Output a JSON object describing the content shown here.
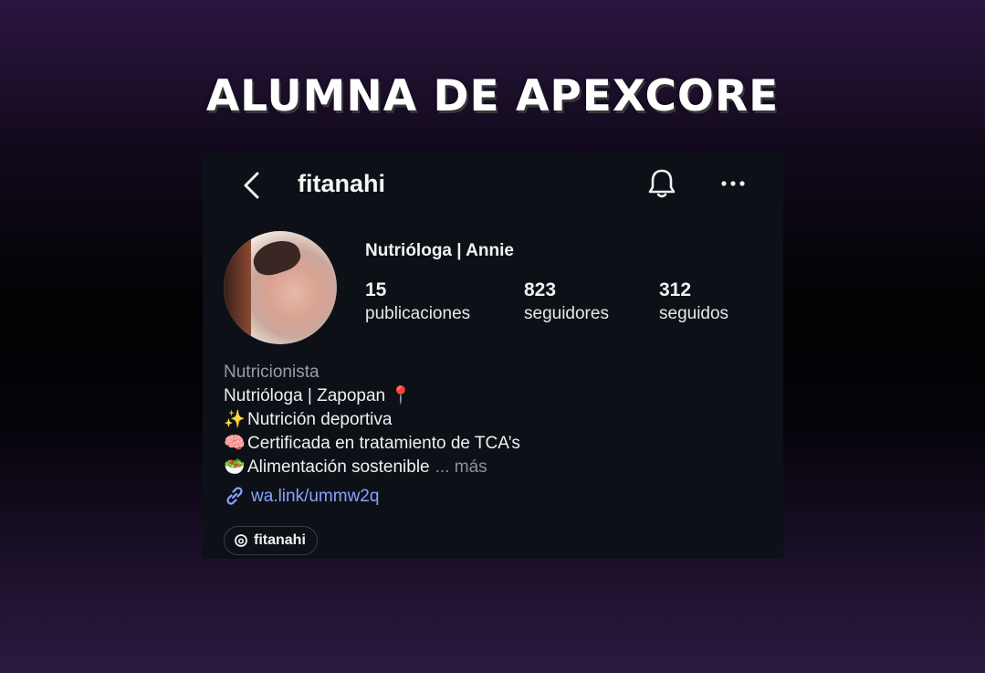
{
  "headline": "ALUMNA DE APEXCORE",
  "profile": {
    "username": "fitanahi",
    "display_name": "Nutrióloga | Annie",
    "stats": [
      {
        "value": "15",
        "label": "publicaciones"
      },
      {
        "value": "823",
        "label": "seguidores"
      },
      {
        "value": "312",
        "label": "seguidos"
      }
    ],
    "category": "Nutricionista",
    "bio_lines": [
      {
        "emoji": "",
        "text": "Nutrióloga | Zapopan 📍"
      },
      {
        "emoji": "✨",
        "text": "Nutrición deportiva"
      },
      {
        "emoji": "🧠",
        "text": "Certificada en tratamiento de TCA’s"
      },
      {
        "emoji": "🥗",
        "text": "Alimentación sostenible"
      }
    ],
    "more_label": "... más",
    "link": "wa.link/ummw2q",
    "threads_handle": "fitanahi"
  },
  "icons": {
    "back": "chevron-left-icon",
    "notifications": "bell-icon",
    "options": "more-horizontal-icon",
    "link": "link-icon",
    "threads": "threads-icon"
  },
  "colors": {
    "card_bg": "#0d1117",
    "link": "#8aa4ff",
    "secondary_text": "#9a9ca2"
  }
}
